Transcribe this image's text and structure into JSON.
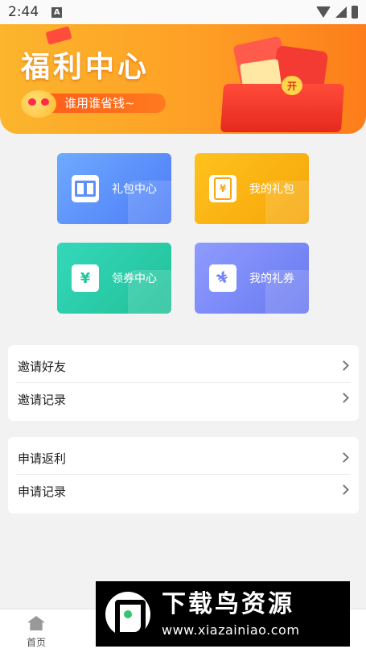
{
  "status_bar": {
    "time": "2:44",
    "notification_letter": "A"
  },
  "banner": {
    "title": "福利中心",
    "subtitle": "谁用谁省钱~",
    "coin_label": "开"
  },
  "tiles": [
    {
      "label": "礼包中心",
      "icon": "gift-icon"
    },
    {
      "label": "我的礼包",
      "icon": "red-envelope-icon",
      "glyph": "¥"
    },
    {
      "label": "领券中心",
      "icon": "coupon-icon",
      "glyph": "¥"
    },
    {
      "label": "我的礼券",
      "icon": "ticket-icon",
      "glyph": "¥"
    }
  ],
  "invite_card": {
    "items": [
      {
        "label": "邀请好友"
      },
      {
        "label": "邀请记录"
      }
    ]
  },
  "rebate_card": {
    "items": [
      {
        "label": "申请返利"
      },
      {
        "label": "申请记录"
      }
    ]
  },
  "bottom_nav": {
    "items": [
      {
        "label": "首页",
        "icon": "home-icon"
      }
    ]
  },
  "watermark": {
    "title": "下载鸟资源",
    "url": "www.xiazainiao.com"
  }
}
